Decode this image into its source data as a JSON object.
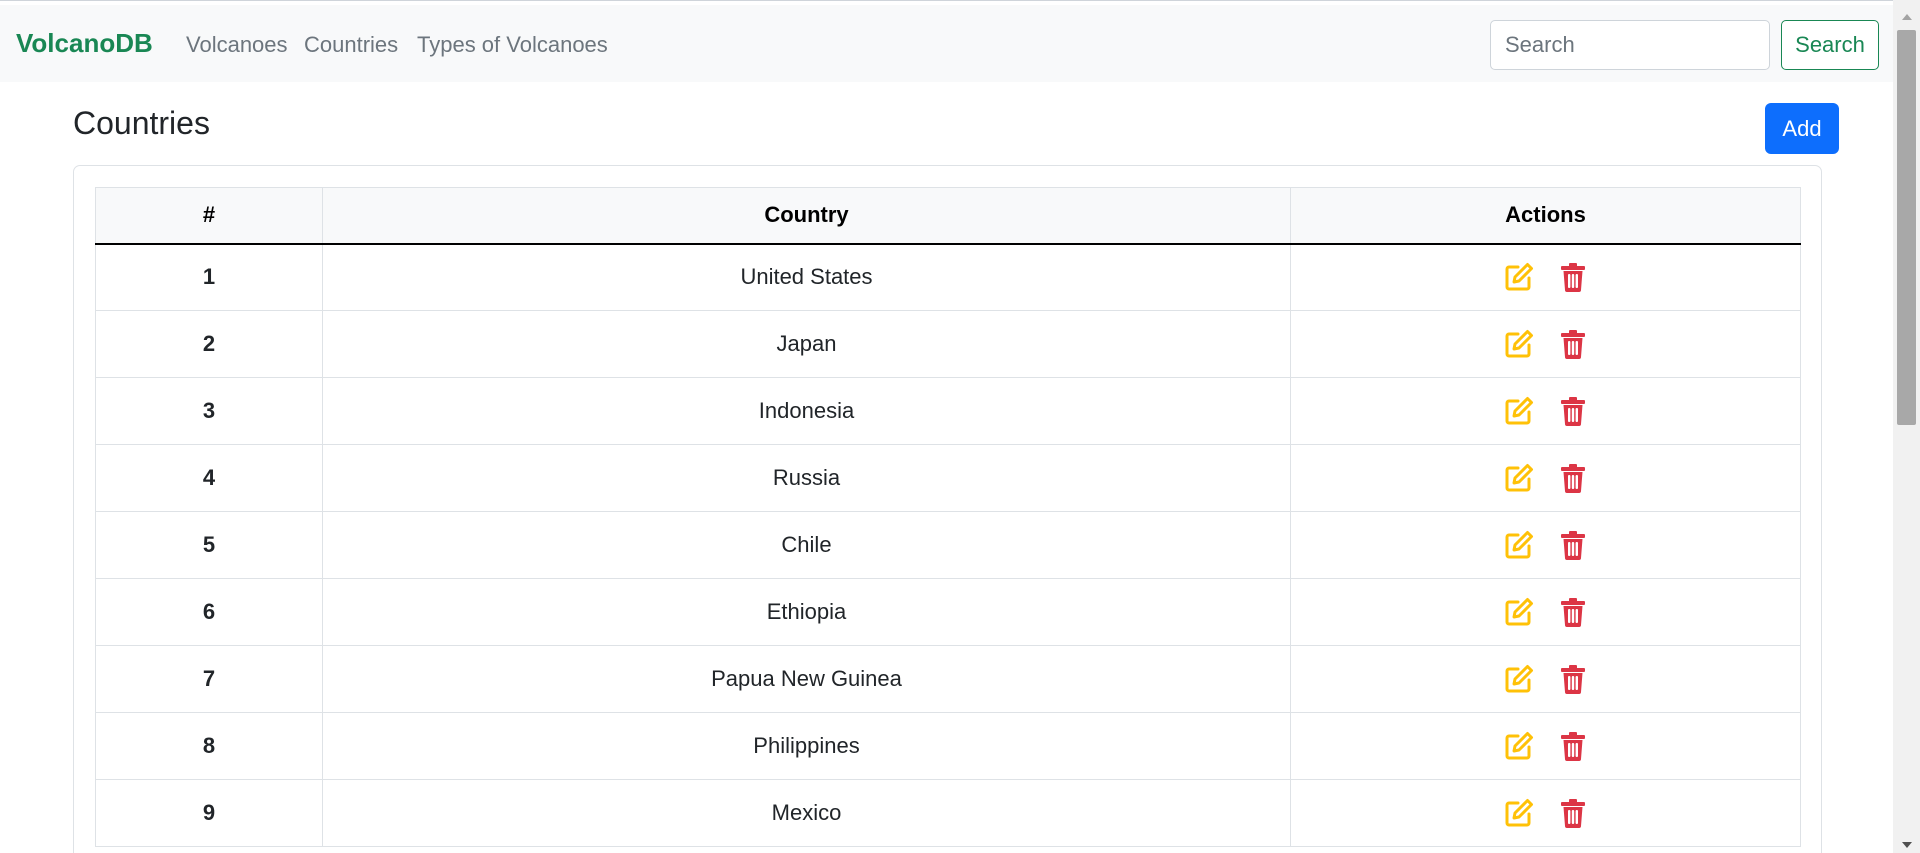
{
  "navbar": {
    "brand": "VolcanoDB",
    "links": [
      {
        "label": "Volcanoes"
      },
      {
        "label": "Countries"
      },
      {
        "label": "Types of Volcanoes"
      }
    ],
    "search_placeholder": "Search",
    "search_button": "Search"
  },
  "page": {
    "title": "Countries",
    "add_button": "Add"
  },
  "table": {
    "columns": [
      "#",
      "Country",
      "Actions"
    ],
    "rows": [
      {
        "num": "1",
        "country": "United States"
      },
      {
        "num": "2",
        "country": "Japan"
      },
      {
        "num": "3",
        "country": "Indonesia"
      },
      {
        "num": "4",
        "country": "Russia"
      },
      {
        "num": "5",
        "country": "Chile"
      },
      {
        "num": "6",
        "country": "Ethiopia"
      },
      {
        "num": "7",
        "country": "Papua New Guinea"
      },
      {
        "num": "8",
        "country": "Philippines"
      },
      {
        "num": "9",
        "country": "Mexico"
      }
    ],
    "row_actions": [
      "edit-icon",
      "trash-icon"
    ]
  },
  "colors": {
    "brand": "#198754",
    "primary": "#0d6efd",
    "edit": "#ffc107",
    "delete": "#dc3545",
    "navbar_bg": "#f8f9fa"
  }
}
